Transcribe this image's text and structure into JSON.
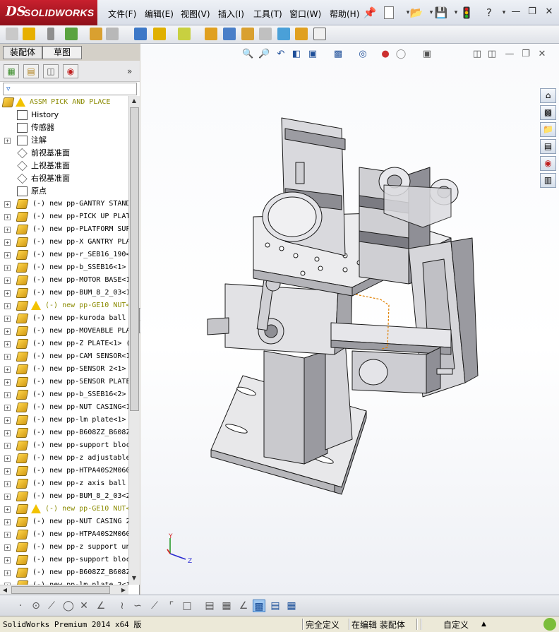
{
  "app": {
    "logo_mark": "DS",
    "logo_text": "SOLIDWORKS"
  },
  "menu": [
    {
      "label": "文件(F)"
    },
    {
      "label": "编辑(E)"
    },
    {
      "label": "视图(V)"
    },
    {
      "label": "插入(I)"
    },
    {
      "label": "工具(T)"
    },
    {
      "label": "窗口(W)"
    },
    {
      "label": "帮助(H)"
    }
  ],
  "tabs": {
    "assembly": "装配体",
    "sketch": "草图"
  },
  "tree": {
    "root": "ASSM PICK AND PLACE",
    "items": [
      {
        "label": "History",
        "icon": "history-icon"
      },
      {
        "label": "传感器",
        "icon": "sensor-icon"
      },
      {
        "label": "注解",
        "icon": "annotation-icon"
      },
      {
        "label": "前视基准面",
        "icon": "plane-icon"
      },
      {
        "label": "上视基准面",
        "icon": "plane-icon"
      },
      {
        "label": "右视基准面",
        "icon": "plane-icon"
      },
      {
        "label": "原点",
        "icon": "origin-icon"
      },
      {
        "label": "(-) new pp-GANTRY STAND"
      },
      {
        "label": "(-) new pp-PICK UP PLAT"
      },
      {
        "label": "(-) new pp-PLATFORM SUP"
      },
      {
        "label": "(-) new pp-X GANTRY PLA"
      },
      {
        "label": "(-) new pp-r_SEB16_190<"
      },
      {
        "label": "(-) new pp-b_SSEB16<1>"
      },
      {
        "label": "(-) new pp-MOTOR BASE<1"
      },
      {
        "label": "(-) new pp-BUM_8_2_03<1"
      },
      {
        "label": "(-) new pp-GE10 NUT<",
        "warning": true
      },
      {
        "label": "(-) new pp-kuroda ball"
      },
      {
        "label": "(-) new pp-MOVEABLE PLA"
      },
      {
        "label": "(-) new pp-Z PLATE<1> ("
      },
      {
        "label": "(-) new pp-CAM SENSOR<1"
      },
      {
        "label": "(-) new pp-SENSOR 2<1>"
      },
      {
        "label": "(-) new pp-SENSOR PLATE"
      },
      {
        "label": "(-) new pp-b_SSEB16<2>"
      },
      {
        "label": "(-) new pp-NUT CASING<1"
      },
      {
        "label": "(-) new pp-lm plate<1>"
      },
      {
        "label": "(-) new pp-B608ZZ_B608Z"
      },
      {
        "label": "(-) new pp-support bloc"
      },
      {
        "label": "(-) new pp-z adjustable"
      },
      {
        "label": "(-) new pp-HTPA40S2M060"
      },
      {
        "label": "(-) new pp-z axis ball"
      },
      {
        "label": "(-) new pp-BUM_8_2_03<2"
      },
      {
        "label": "(-) new pp-GE10 NUT<",
        "warning": true
      },
      {
        "label": "(-) new pp-NUT CASING 2"
      },
      {
        "label": "(-) new pp-HTPA40S2M060"
      },
      {
        "label": "(-) new pp-z support un"
      },
      {
        "label": "(-) new pp-support bloc"
      },
      {
        "label": "(-) new pp-B608ZZ_B608Z"
      },
      {
        "label": "(-) new pp-lm plate 2<1"
      }
    ]
  },
  "triad": {
    "y": "Y",
    "z": "Z"
  },
  "status": {
    "product": "SolidWorks Premium 2014 x64 版",
    "defined": "完全定义",
    "editing": "在编辑 装配体",
    "units": "自定义"
  },
  "colors": {
    "logo": "#b51a26",
    "highlight": "#1a63c9",
    "warning_text": "#8a8a00"
  }
}
